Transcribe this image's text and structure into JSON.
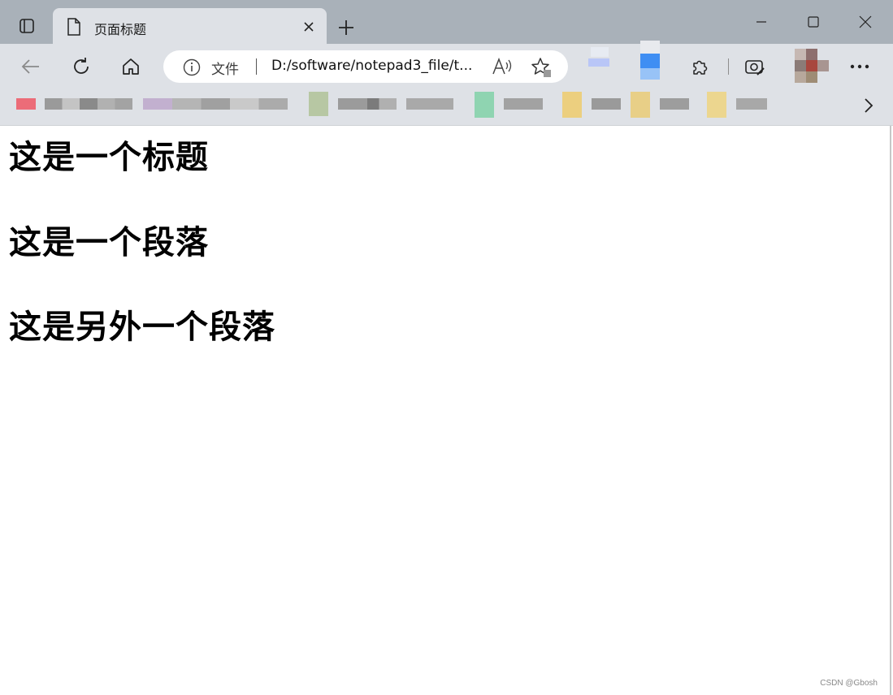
{
  "window": {
    "tab_title": "页面标题",
    "controls": [
      "minimize",
      "maximize",
      "close"
    ]
  },
  "toolbar": {
    "address_prefix": "文件",
    "address_url": "D:/software/notepad3_file/t...",
    "readaloud_label": "A⁾"
  },
  "page": {
    "title": "这是一个标题",
    "paragraph_1": "这是一个段落",
    "paragraph_2": "这是另外一个段落"
  },
  "watermark": "CSDN @Gbosh",
  "colors": {
    "titlebar": "#a9b1b9",
    "tab": "#dee1e6",
    "toolbar": "#dee1e6",
    "content_bg": "#ffffff"
  }
}
